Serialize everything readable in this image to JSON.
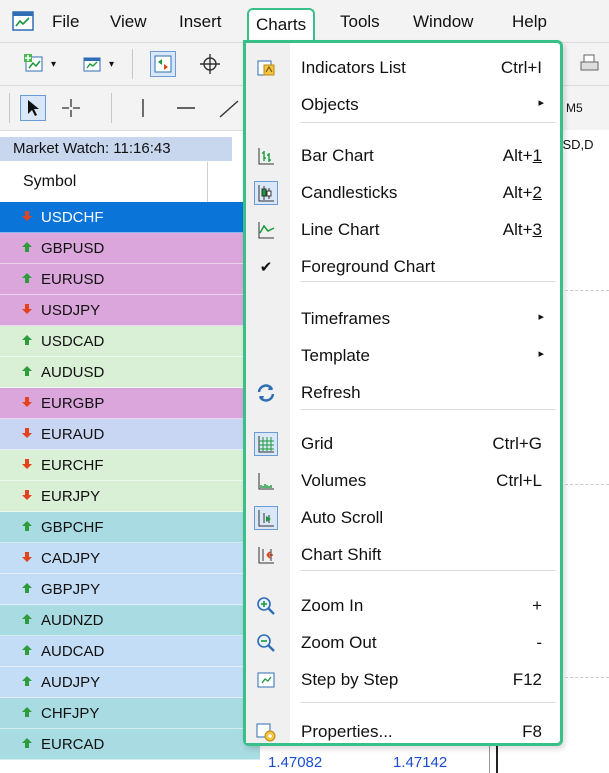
{
  "menubar": {
    "items": [
      {
        "label": "File"
      },
      {
        "label": "View"
      },
      {
        "label": "Insert"
      },
      {
        "label": "Charts"
      },
      {
        "label": "Tools"
      },
      {
        "label": "Window"
      },
      {
        "label": "Help"
      }
    ]
  },
  "chart": {
    "tab_fragment": "JSD,D"
  },
  "toolbar2": {
    "m5": "M5"
  },
  "market_watch": {
    "title": "Market Watch: 11:16:43",
    "column_symbol": "Symbol",
    "rows": [
      {
        "symbol": "USDCHF",
        "dir": "down"
      },
      {
        "symbol": "GBPUSD",
        "dir": "up"
      },
      {
        "symbol": "EURUSD",
        "dir": "up"
      },
      {
        "symbol": "USDJPY",
        "dir": "down"
      },
      {
        "symbol": "USDCAD",
        "dir": "up"
      },
      {
        "symbol": "AUDUSD",
        "dir": "up"
      },
      {
        "symbol": "EURGBP",
        "dir": "down"
      },
      {
        "symbol": "EURAUD",
        "dir": "down"
      },
      {
        "symbol": "EURCHF",
        "dir": "down"
      },
      {
        "symbol": "EURJPY",
        "dir": "down"
      },
      {
        "symbol": "GBPCHF",
        "dir": "up"
      },
      {
        "symbol": "CADJPY",
        "dir": "down"
      },
      {
        "symbol": "GBPJPY",
        "dir": "up"
      },
      {
        "symbol": "AUDNZD",
        "dir": "up"
      },
      {
        "symbol": "AUDCAD",
        "dir": "up"
      },
      {
        "symbol": "AUDJPY",
        "dir": "up"
      },
      {
        "symbol": "CHFJPY",
        "dir": "up"
      },
      {
        "symbol": "EURCAD",
        "dir": "up"
      }
    ],
    "last_bid": "1.47082",
    "last_ask": "1.47142"
  },
  "charts_menu": {
    "items": [
      {
        "label": "Indicators List",
        "shortcut": "Ctrl+I",
        "icon": "indicators-list-icon"
      },
      {
        "label": "Objects",
        "submenu": true
      },
      {
        "label": "Bar Chart",
        "shortcut": "Alt+1",
        "icon": "bar-chart-icon"
      },
      {
        "label": "Candlesticks",
        "shortcut": "Alt+2",
        "icon": "candlesticks-icon",
        "checked_frame": true
      },
      {
        "label": "Line Chart",
        "shortcut": "Alt+3",
        "icon": "line-chart-icon"
      },
      {
        "label": "Foreground Chart",
        "checked": true,
        "check_mark": "✔"
      },
      {
        "label": "Timeframes",
        "submenu": true
      },
      {
        "label": "Template",
        "submenu": true
      },
      {
        "label": "Refresh",
        "icon": "refresh-icon"
      },
      {
        "label": "Grid",
        "shortcut": "Ctrl+G",
        "icon": "grid-icon",
        "checked_frame": true
      },
      {
        "label": "Volumes",
        "shortcut": "Ctrl+L",
        "icon": "volumes-icon"
      },
      {
        "label": "Auto Scroll",
        "icon": "auto-scroll-icon",
        "checked_frame": true
      },
      {
        "label": "Chart Shift",
        "icon": "chart-shift-icon"
      },
      {
        "label": "Zoom In",
        "shortcut": "+",
        "icon": "zoom-in-icon"
      },
      {
        "label": "Zoom Out",
        "shortcut": "-",
        "icon": "zoom-out-icon"
      },
      {
        "label": "Step by Step",
        "shortcut": "F12",
        "icon": "step-by-step-icon"
      },
      {
        "label": "Properties...",
        "shortcut": "F8",
        "icon": "properties-icon"
      }
    ],
    "submenu_arrow": "▸"
  },
  "colors": {
    "accent_frame": "#38c08a",
    "selected_row": "#0a74d8",
    "row_magenta": "#dba6dc",
    "row_green": "#d9f0d6",
    "row_blue": "#c9d6f3",
    "row_teal": "#a9dbe2",
    "row_lightblue": "#c4ddf7",
    "arrow_up": "#2e9c3a",
    "arrow_down": "#e2431c"
  }
}
